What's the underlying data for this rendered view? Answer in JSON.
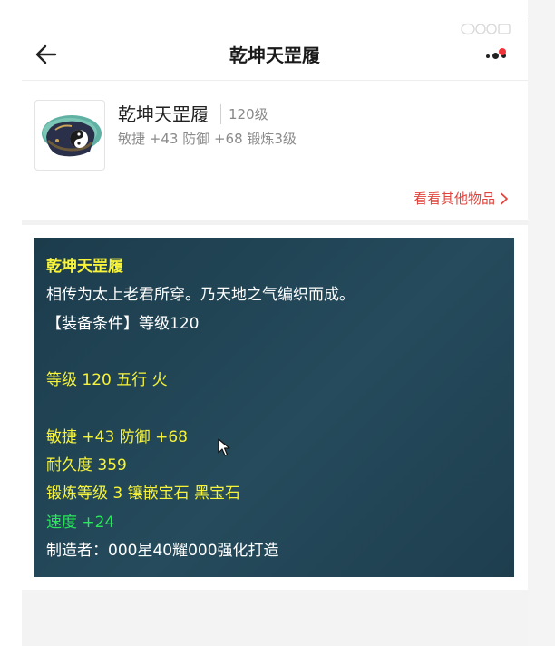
{
  "header": {
    "title": "乾坤天罡履",
    "back_icon": "arrow-left-icon",
    "more_icon": "more-dots-icon",
    "notification_color": "#f0363a"
  },
  "item": {
    "icon": "shoe-item-icon",
    "name": "乾坤天罡履",
    "level": "120级",
    "stats": "敏捷 +43 防御 +68 锻炼3级",
    "other_items_link": "看看其他物品"
  },
  "tooltip": {
    "name": "乾坤天罡履",
    "description": "相传为太上老君所穿。乃天地之气编织而成。",
    "requirement": "【装备条件】等级120",
    "level_element": "等级 120 五行 火",
    "attributes": "敏捷 +43 防御 +68",
    "durability": "耐久度 359",
    "forging": "锻炼等级 3 镶嵌宝石 黑宝石",
    "speed": "速度 +24",
    "maker": "制造者：000星40耀000强化打造"
  },
  "colors": {
    "accent_red": "#e0443d",
    "tooltip_bg": "#1f4252",
    "text_yellow": "#f6f33a",
    "text_green": "#29e85a"
  }
}
